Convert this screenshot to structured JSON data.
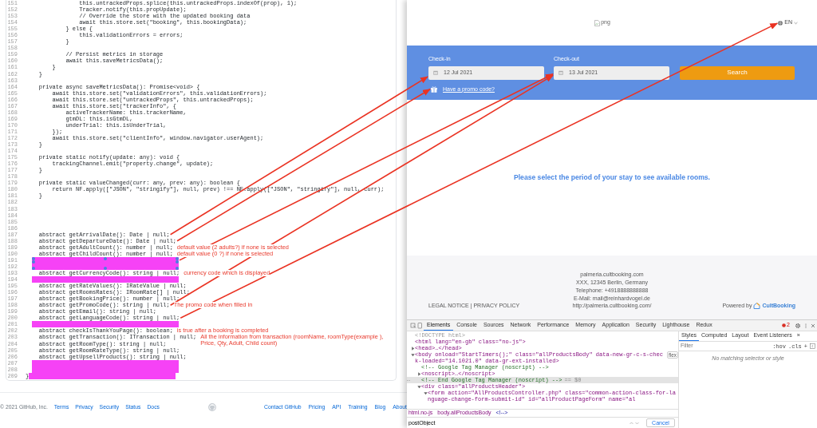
{
  "code_view": {
    "lines": [
      {
        "number": "151",
        "code": "                this.untrackedProps.splice(this.untrackedProps.indexOf(prop), 1);",
        "redacted": false
      },
      {
        "number": "152",
        "code": "                Tracker.notify(this.propUpdate);",
        "redacted": false
      },
      {
        "number": "153",
        "code": "                // Override the store with the updated booking data",
        "redacted": false
      },
      {
        "number": "154",
        "code": "                await this.store.set(\"booking\", this.bookingData);",
        "redacted": false
      },
      {
        "number": "155",
        "code": "            } else {",
        "redacted": false
      },
      {
        "number": "156",
        "code": "                this.validationErrors = errors;",
        "redacted": false
      },
      {
        "number": "157",
        "code": "            }",
        "redacted": false
      },
      {
        "number": "158",
        "redacted": false
      },
      {
        "number": "159",
        "code": "            // Persist metrics in storage",
        "redacted": false
      },
      {
        "number": "160",
        "code": "            await this.saveMetricsData();",
        "redacted": false
      },
      {
        "number": "161",
        "code": "        }",
        "redacted": false
      },
      {
        "number": "162",
        "code": "    }",
        "redacted": false
      },
      {
        "number": "163",
        "redacted": false
      },
      {
        "number": "164",
        "code": "    private async saveMetricsData(): Promise<void> {",
        "redacted": false
      },
      {
        "number": "165",
        "code": "        await this.store.set(\"validationErrors\", this.validationErrors);",
        "redacted": false
      },
      {
        "number": "166",
        "code": "        await this.store.set(\"untrackedProps\", this.untrackedProps);",
        "redacted": false
      },
      {
        "number": "167",
        "code": "        await this.store.set(\"trackerInfo\", {",
        "redacted": false
      },
      {
        "number": "168",
        "code": "            activeTrackerName: this.trackerName,",
        "redacted": false
      },
      {
        "number": "169",
        "code": "            gtmDL: this.isGtmDL,",
        "redacted": false
      },
      {
        "number": "170",
        "code": "            underTrial: this.isUnderTrial,",
        "redacted": false
      },
      {
        "number": "171",
        "code": "        });",
        "redacted": false
      },
      {
        "number": "172",
        "code": "        await this.store.set(\"clientInfo\", window.navigator.userAgent);",
        "redacted": false
      },
      {
        "number": "173",
        "code": "    }",
        "redacted": false
      },
      {
        "number": "174",
        "redacted": false
      },
      {
        "number": "175",
        "code": "    private static notify(update: any): void {",
        "redacted": false
      },
      {
        "number": "176",
        "code": "        trackingChannel.emit(\"property.change\", update);",
        "redacted": false
      },
      {
        "number": "177",
        "code": "    }",
        "redacted": false
      },
      {
        "number": "178",
        "redacted": false
      },
      {
        "number": "179",
        "code": "    private static valueChanged(curr: any, prev: any): boolean {",
        "redacted": false
      },
      {
        "number": "180",
        "code": "        return NF.apply([\"JSON\", \"stringify\"], null, prev) !== NF.apply([\"JSON\", \"stringify\"], null, curr);",
        "redacted": false
      },
      {
        "number": "181",
        "code": "    }",
        "redacted": false
      },
      {
        "number": "182",
        "redacted": false
      },
      {
        "number": "183",
        "redacted": false
      },
      {
        "number": "184",
        "redacted": false
      },
      {
        "number": "185",
        "redacted": false
      },
      {
        "number": "186",
        "redacted": false
      },
      {
        "number": "187",
        "code": "    abstract getArrivalDate(): Date | null;",
        "redacted": false
      },
      {
        "number": "188",
        "code": "    abstract getDepartureDate(): Date | null;",
        "redacted": false
      },
      {
        "number": "189",
        "code": "    abstract getAdultCount(): number | null;",
        "note": "default value (2 adults?) if none is selected",
        "redacted": false
      },
      {
        "number": "190",
        "code": "    abstract getChildCount(): number | null;",
        "note": "default value (0 ?) if none is selected",
        "redacted": false
      },
      {
        "number": "191",
        "redacted": true,
        "selected": true
      },
      {
        "number": "192",
        "redacted": true,
        "selected": true
      },
      {
        "number": "193",
        "code": "    abstract getCurrencyCode(): string | null;",
        "note": "currency code which is displayed",
        "redacted": false
      },
      {
        "number": "194",
        "redacted": true,
        "selected": false
      },
      {
        "number": "195",
        "code": "    abstract getRateValues(): IRateValue | null;",
        "redacted": false
      },
      {
        "number": "196",
        "code": "    abstract getRoomsRates(): IRoomRate[] | null;",
        "redacted": false
      },
      {
        "number": "197",
        "code": "    abstract getBookingPrice(): number | null;",
        "redacted": false
      },
      {
        "number": "198",
        "code": "    abstract getPromoCode(): string | null;",
        "note": "The promo code when filled in",
        "redacted": false
      },
      {
        "number": "199",
        "code": "    abstract getEmail(): string | null;",
        "redacted": false
      },
      {
        "number": "200",
        "code": "    abstract getLanguageCode(): string | null;",
        "redacted": false
      },
      {
        "number": "201",
        "redacted": true,
        "selected": false
      },
      {
        "number": "202",
        "code": "    abstract checkIsThankYouPage(): boolean;",
        "note": "is true after a booking is completed",
        "redacted": false
      },
      {
        "number": "203",
        "code": "    abstract getTransaction(): ITransaction | null;",
        "note": "All the information from transaction (roomName, roomType(example ), Price, Qty, Adult, Child count)",
        "redacted": false
      },
      {
        "number": "204",
        "code": "    abstract getRoomType(): string | null;",
        "redacted": false
      },
      {
        "number": "205",
        "code": "    abstract getRoomRateType(): string | null;",
        "redacted": false
      },
      {
        "number": "206",
        "code": "    abstract getUpsellProducts(): string | null;",
        "redacted": false
      },
      {
        "number": "207",
        "redacted": true,
        "selected": false
      },
      {
        "number": "208",
        "redacted": true,
        "selected": false
      },
      {
        "number": "209",
        "code": "}",
        "redacted": true,
        "selected": false
      }
    ]
  },
  "github_footer": {
    "copyright": "© 2021 GitHub, Inc.",
    "left_links": [
      "Terms",
      "Privacy",
      "Security",
      "Status",
      "Docs"
    ],
    "right_links": [
      "Contact GitHub",
      "Pricing",
      "API",
      "Training",
      "Blog",
      "About"
    ]
  },
  "booking_page": {
    "header": {
      "image_alt": "png",
      "language": "EN"
    },
    "search_form": {
      "checkin_label": "Check-in",
      "checkin_value": "12 Jul 2021",
      "checkout_label": "Check-out",
      "checkout_value": "13 Jul 2021",
      "search_button": "Search",
      "promo_link": "Have a promo code?"
    },
    "message": "Please select the period of your stay to see available rooms.",
    "footer": {
      "legal_links": "LEGAL NOTICE | PRIVACY POLICY",
      "address_lines": [
        "palmeria.cultbooking.com",
        "XXX, 12345 Berlin, Germany",
        "Telephone: +4918888888888",
        "E-Mail: mail@reinhardvogel.de",
        "http://palmeria.cultbooking.com/"
      ],
      "powered_by": "Powered by",
      "brand": "CultBooking"
    }
  },
  "devtools": {
    "tabs": [
      {
        "label": "Elements",
        "selected": true
      },
      {
        "label": "Console",
        "selected": false
      },
      {
        "label": "Sources",
        "selected": false
      },
      {
        "label": "Network",
        "selected": false
      },
      {
        "label": "Performance",
        "selected": false
      },
      {
        "label": "Memory",
        "selected": false
      },
      {
        "label": "Application",
        "selected": false
      },
      {
        "label": "Security",
        "selected": false
      },
      {
        "label": "Lighthouse",
        "selected": false
      },
      {
        "label": "Redux",
        "selected": false
      }
    ],
    "error_count": "2",
    "dom_tree": [
      {
        "text": "<!DOCTYPE html>",
        "kind": "doctype",
        "selected": false
      },
      {
        "text": "<html lang=\"en-gb\" class=\"no-js\">",
        "kind": "tag",
        "selected": false,
        "children": [
          {
            "text": "<head>…</head>",
            "kind": "tag",
            "expanded": false,
            "selected": false
          },
          {
            "text": "<body onload=\"StartTimers();\" class=\"allProductsBody\" data-new-gr-c-s-check-loaded=\"14.1021.0\" data-gr-ext-installed>",
            "kind": "tag",
            "expanded": true,
            "badge": "flex",
            "selected": false,
            "children": [
              {
                "text": "<!-- Google Tag Manager (noscript) -->",
                "kind": "comment",
                "selected": false
              },
              {
                "text": "<noscript>…</noscript>",
                "kind": "tag",
                "expanded": false,
                "selected": false
              },
              {
                "text": "<!-- End Google Tag Manager (noscript) -->",
                "kind": "comment",
                "suffix": "== $0",
                "selected": true
              },
              {
                "text": "<div class=\"allProductsHeader\">",
                "kind": "tag",
                "expanded": true,
                "selected": false,
                "children": [
                  {
                    "text": "<form action=\"AllProductsController.php\" class=\"common-action-class-for-language-change-form-submit-id\" id=\"allProductPageForm\" name=\"al",
                    "kind": "tag",
                    "expanded": true,
                    "selected": false
                  }
                ]
              }
            ]
          }
        ]
      }
    ],
    "breadcrumbs": [
      "html.no-js",
      "body.allProductsBody",
      "<!-->"
    ],
    "search": {
      "value": "postObject"
    },
    "cancel_button": "Cancel",
    "styles_tabs": [
      {
        "label": "Styles",
        "selected": true
      },
      {
        "label": "Computed",
        "selected": false
      },
      {
        "label": "Layout",
        "selected": false
      },
      {
        "label": "Event Listeners",
        "selected": false
      },
      {
        "label": "»",
        "selected": false
      }
    ],
    "filter": {
      "placeholder": "Filter"
    },
    "filter_tools": [
      ":hov",
      ".cls",
      "+"
    ],
    "styles_message": "No matching selector or style"
  }
}
